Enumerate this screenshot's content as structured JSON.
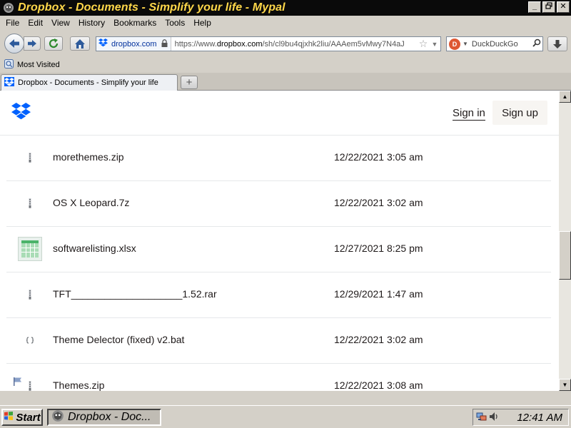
{
  "window": {
    "title": "Dropbox - Documents - Simplify your life - Mypal",
    "controls": [
      "minimize",
      "restore",
      "close"
    ]
  },
  "menubar": {
    "items": [
      {
        "label": "File"
      },
      {
        "label": "Edit"
      },
      {
        "label": "View"
      },
      {
        "label": "History"
      },
      {
        "label": "Bookmarks"
      },
      {
        "label": "Tools"
      },
      {
        "label": "Help"
      }
    ]
  },
  "navbar": {
    "identity": "dropbox.com",
    "url_prefix": "https://www.",
    "url_domain": "dropbox.com",
    "url_rest": "/sh/cl9bu4qjxhk2liu/AAAem5vMwy7N4aJ",
    "search_engine": "DuckDuckGo"
  },
  "bookmarks": {
    "most_visited": "Most Visited"
  },
  "tabs": [
    {
      "label": "Dropbox - Documents - Simplify your life"
    }
  ],
  "site": {
    "signin": "Sign in",
    "signup": "Sign up",
    "accent": "#0061fe"
  },
  "files": [
    {
      "name": "morethemes.zip",
      "date": "12/22/2021 3:05 am",
      "icon": "zip-icon",
      "flag": false
    },
    {
      "name": "OS X Leopard.7z",
      "date": "12/22/2021 3:02 am",
      "icon": "zip-icon",
      "flag": false
    },
    {
      "name": "softwarelisting.xlsx",
      "date": "12/27/2021 8:25 pm",
      "icon": "spreadsheet-icon",
      "flag": false
    },
    {
      "name": "TFT____________________1.52.rar",
      "date": "12/29/2021 1:47 am",
      "icon": "zip-icon",
      "flag": false
    },
    {
      "name": "Theme Delector (fixed) v2.bat",
      "date": "12/22/2021 3:02 am",
      "icon": "code-icon",
      "flag": false
    },
    {
      "name": "Themes.zip",
      "date": "12/22/2021 3:08 am",
      "icon": "zip-icon",
      "flag": true
    }
  ],
  "taskbar": {
    "start": "Start",
    "task": "Dropbox - Doc...",
    "clock": "12:41 AM"
  }
}
